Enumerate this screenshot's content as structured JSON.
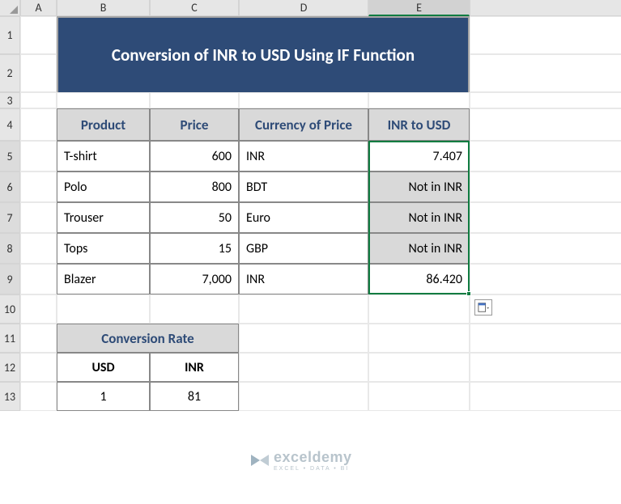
{
  "columns": [
    "A",
    "B",
    "C",
    "D",
    "E"
  ],
  "rows": [
    "1",
    "2",
    "3",
    "4",
    "5",
    "6",
    "7",
    "8",
    "9",
    "10",
    "11",
    "12",
    "13"
  ],
  "title": "Conversion of INR to USD Using IF Function",
  "table": {
    "headers": [
      "Product",
      "Price",
      "Currency of Price",
      "INR to USD"
    ],
    "rows": [
      {
        "product": "T-shirt",
        "price": "600",
        "currency": "INR",
        "result": "7.407",
        "shaded": false
      },
      {
        "product": "Polo",
        "price": "800",
        "currency": "BDT",
        "result": "Not in INR",
        "shaded": true
      },
      {
        "product": "Trouser",
        "price": "50",
        "currency": "Euro",
        "result": "Not in INR",
        "shaded": true
      },
      {
        "product": "Tops",
        "price": "15",
        "currency": "GBP",
        "result": "Not in INR",
        "shaded": true
      },
      {
        "product": "Blazer",
        "price": "7,000",
        "currency": "INR",
        "result": "86.420",
        "shaded": false
      }
    ]
  },
  "conversion": {
    "title": "Conversion Rate",
    "headers": [
      "USD",
      "INR"
    ],
    "values": [
      "1",
      "81"
    ]
  },
  "watermark": {
    "name": "exceldemy",
    "tagline": "EXCEL • DATA • BI"
  },
  "selected_column": "E"
}
